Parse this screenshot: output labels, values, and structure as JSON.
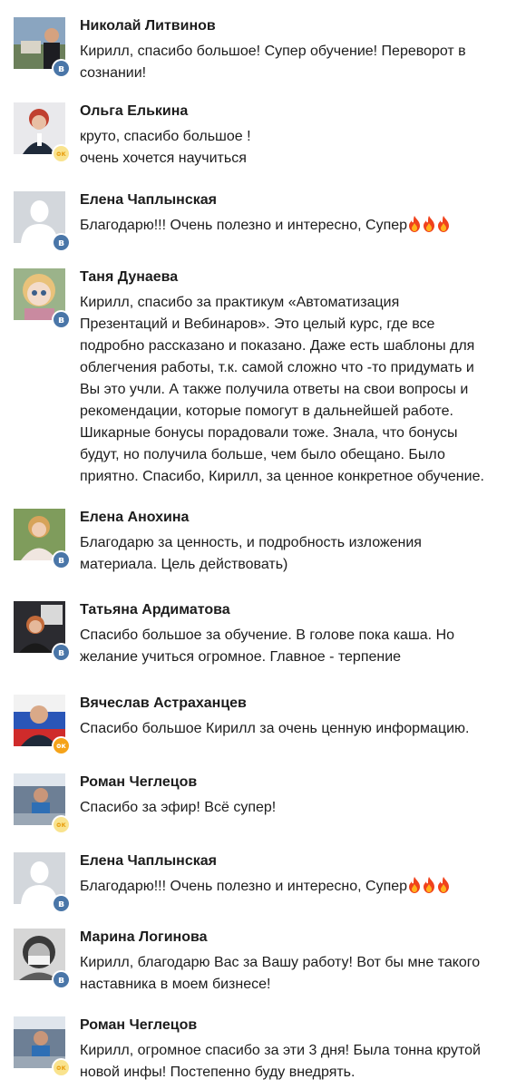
{
  "comments": [
    {
      "name": "Николай Литвинов",
      "text": "Кирилл, спасибо большое! Супер обучение! Переворот в\nсознании!",
      "badge": "vk",
      "badge_glyph": "в",
      "emoji_count": 0
    },
    {
      "name": "Ольга Елькина",
      "text": "круто, спасибо большое !\nочень хочется научиться",
      "badge": "ok-light",
      "badge_glyph": "ok",
      "emoji_count": 0
    },
    {
      "name": "Елена Чаплынская",
      "text": "Благодарю!!! Очень полезно и интересно, Супер",
      "badge": "vk",
      "badge_glyph": "в",
      "emoji_count": 3
    },
    {
      "name": "Таня Дунаева",
      "text": "Кирилл, спасибо за практикум «Автоматизация\nПрезентаций и Вебинаров». Это целый курс, где все\nподробно рассказано и показано. Даже есть шаблоны для\nоблегчения работы, т.к. самой сложно что -то придумать и\nВы это учли. А также получила ответы на свои вопросы и\nрекомендации, которые помогут в дальнейшей работе.\nШикарные бонусы порадовали тоже. Знала, что бонусы\nбудут, но получила больше, чем было обещано. Было\nприятно. Спасибо, Кирилл, за ценное конкретное обучение.",
      "badge": "vk",
      "badge_glyph": "в",
      "emoji_count": 0
    },
    {
      "name": "Елена Анохина",
      "text": "Благодарю за ценность, и подробность изложения\nматериала. Цель действовать)",
      "badge": "vk",
      "badge_glyph": "в",
      "emoji_count": 0
    },
    {
      "name": "Татьяна Ардиматова",
      "text": "Спасибо большое за обучение. В голове пока каша. Но\nжелание учиться огромное. Главное - терпение",
      "badge": "vk",
      "badge_glyph": "в",
      "emoji_count": 0
    },
    {
      "name": "Вячеслав Астраханцев",
      "text": "Спасибо большое Кирилл за очень ценную информацию.",
      "badge": "ok-orange",
      "badge_glyph": "ok",
      "emoji_count": 0
    },
    {
      "name": "Роман Чеглецов",
      "text": "Спасибо за эфир! Всё супер!",
      "badge": "ok-light",
      "badge_glyph": "ok",
      "emoji_count": 0
    },
    {
      "name": "Елена Чаплынская",
      "text": "Благодарю!!! Очень полезно и интересно, Супер",
      "badge": "vk",
      "badge_glyph": "в",
      "emoji_count": 3
    },
    {
      "name": "Марина Логинова",
      "text": "Кирилл, благодарю Вас за Вашу работу! Вот бы мне такого\nнаставника в моем бизнесе!",
      "badge": "vk",
      "badge_glyph": "в",
      "emoji_count": 0
    },
    {
      "name": "Роман Чеглецов",
      "text": "Кирилл, огромное спасибо за эти 3 дня! Была тонна крутой\nновой инфы! Постепенно буду внедрять.",
      "badge": "ok-light",
      "badge_glyph": "ok",
      "emoji_count": 0
    }
  ],
  "colors": {
    "vk_badge": "#4a76a8",
    "ok_badge": "#f5a31a",
    "ok_badge_light": "#f9e38e",
    "text": "#1c1c1c",
    "placeholder_avatar": "#c8ccd2"
  }
}
